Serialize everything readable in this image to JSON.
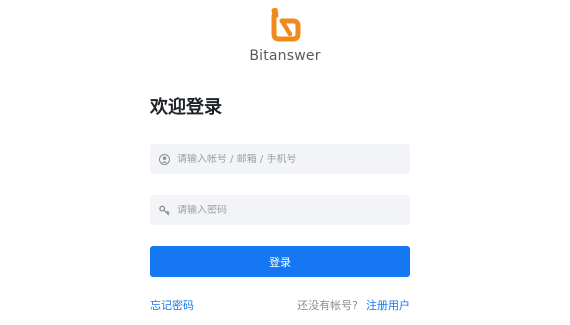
{
  "brand": {
    "name": "Bitanswer",
    "accent_color": "#f08a1c"
  },
  "login": {
    "heading": "欢迎登录",
    "account_placeholder": "请输入帐号 / 邮箱 / 手机号",
    "account_value": "",
    "account_icon": "user-icon",
    "password_placeholder": "请输入密码",
    "password_value": "",
    "password_icon": "key-icon",
    "submit_label": "登录",
    "submit_color": "#1677f3"
  },
  "footer": {
    "forgot_password": "忘记密码",
    "no_account": "还没有帐号?",
    "register": "注册用户"
  }
}
